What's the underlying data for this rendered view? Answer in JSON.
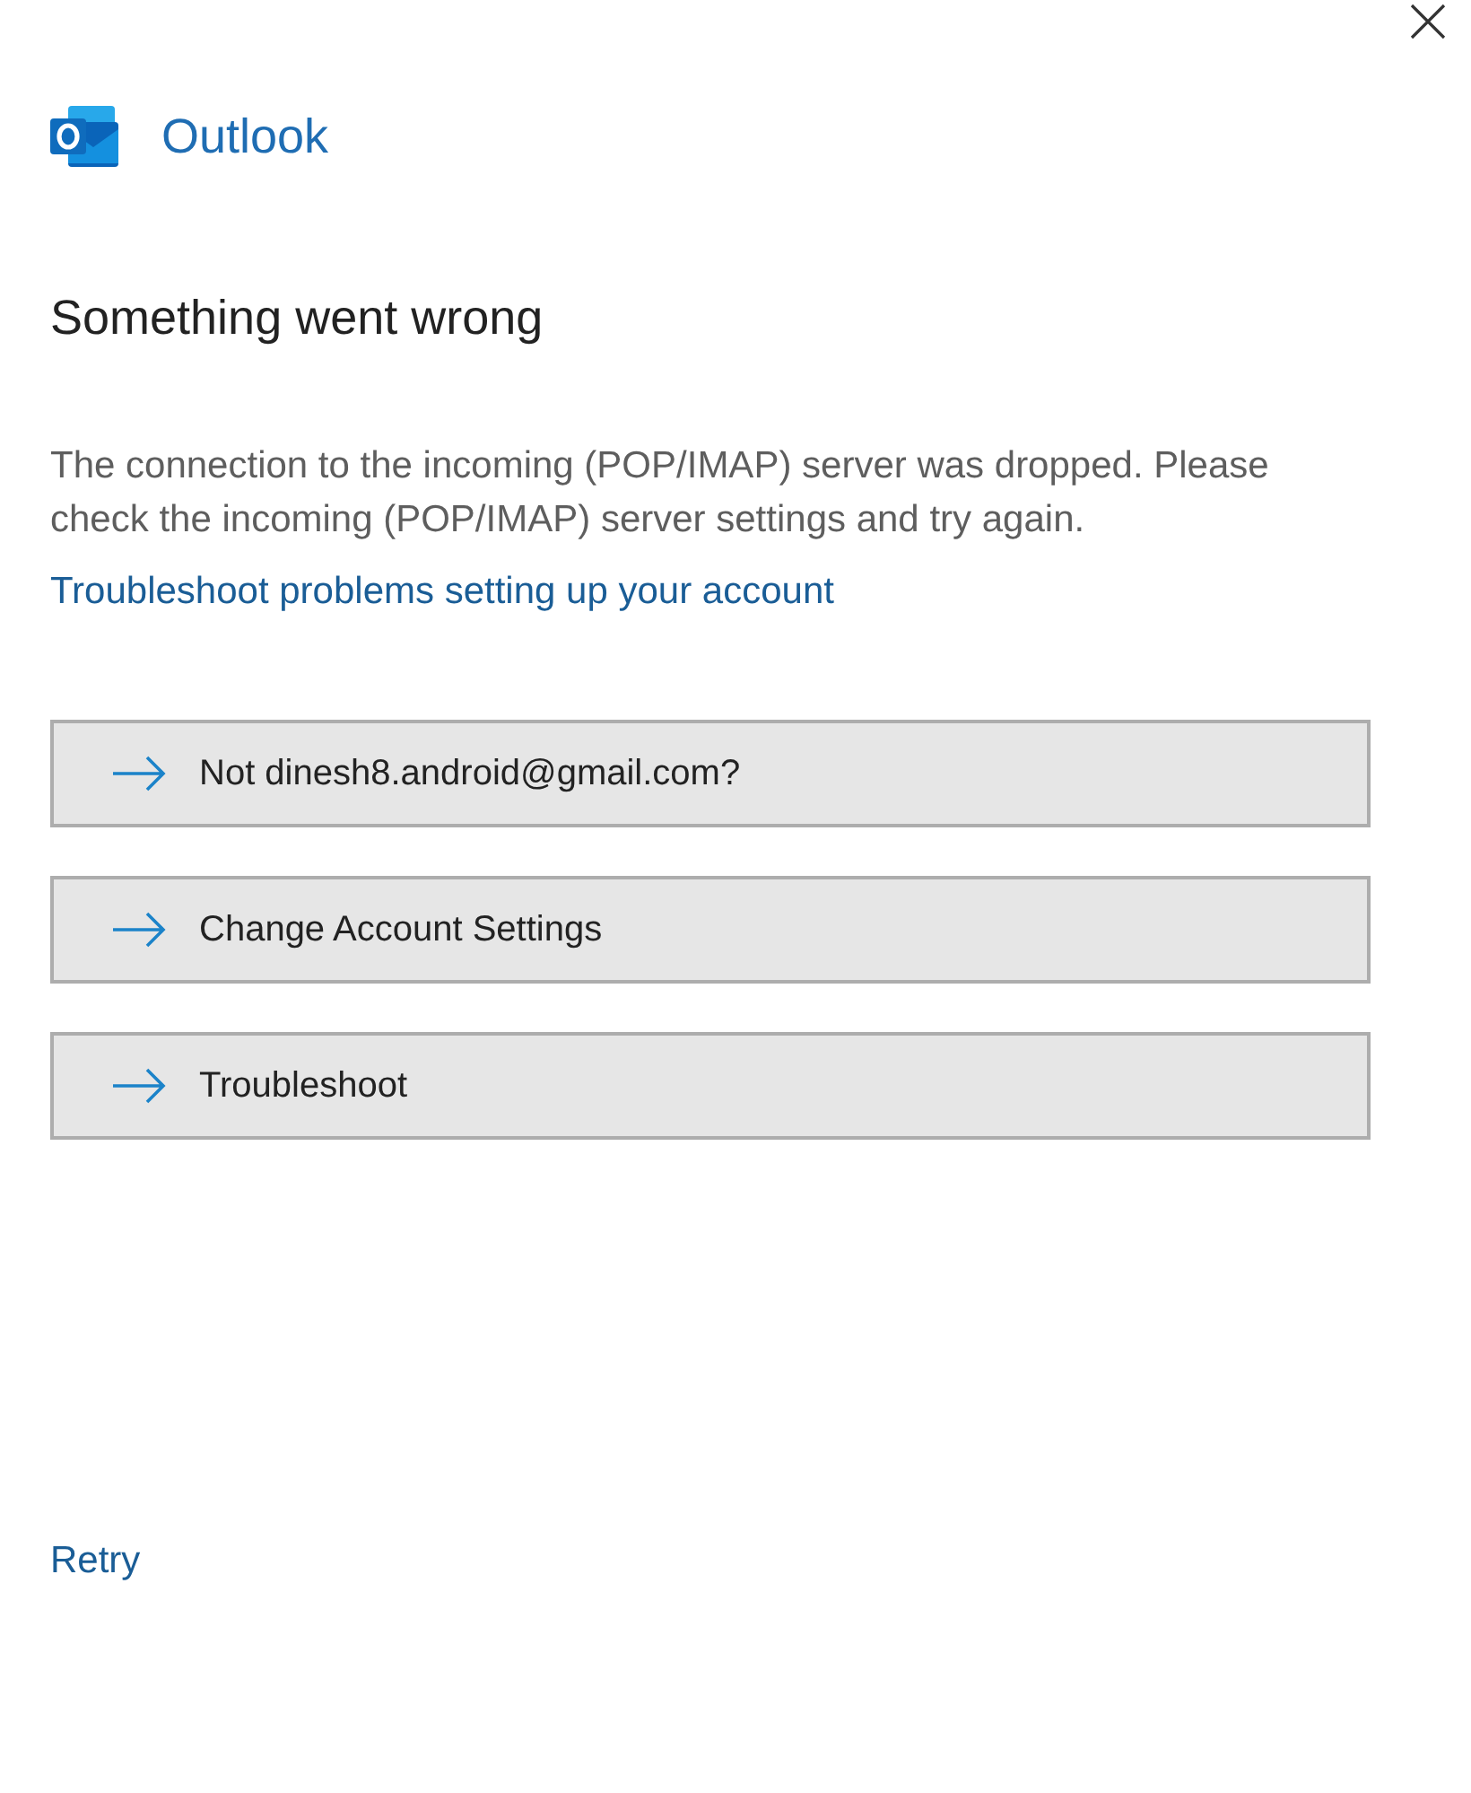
{
  "app": {
    "name": "Outlook"
  },
  "heading": "Something went wrong",
  "message": "The connection to the incoming (POP/IMAP) server was dropped. Please check the incoming (POP/IMAP) server settings and try again.",
  "help_link": "Troubleshoot problems setting up your account",
  "actions": [
    {
      "label": "Not dinesh8.android@gmail.com?"
    },
    {
      "label": "Change Account Settings"
    },
    {
      "label": "Troubleshoot"
    }
  ],
  "retry_link": "Retry"
}
